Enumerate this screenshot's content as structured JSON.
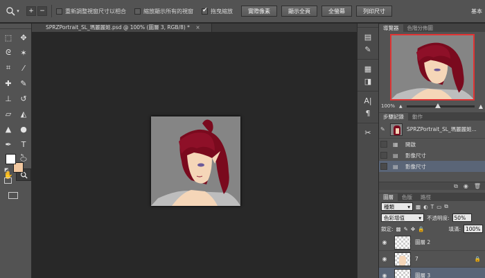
{
  "options_bar": {
    "zoom_in": "+",
    "zoom_out": "−",
    "check_resize_windows": "重新調整視窗尺寸以相合",
    "check_zoom_all_windows": "縮放顯示所有的視窗",
    "check_scrubby_zoom": "拖曳縮放",
    "btn_actual_pixels": "實際像素",
    "btn_fit_screen": "顯示全頁",
    "btn_fill_screen": "全螢幕",
    "btn_print_size": "列印尺寸",
    "workspace": "基本"
  },
  "document": {
    "tab_title": "SPRZPortrait_SL_瑪麗麗姬.psd @ 100% (圖層 3, RGB/8) *",
    "close": "×"
  },
  "navigator": {
    "tab_navigator": "導覽器",
    "tab_histogram": "色階分佈圖",
    "zoom": "100%",
    "zoom_fraction": 0.46
  },
  "history": {
    "tab_history": "步驟記錄",
    "tab_actions": "動作",
    "snapshot": "SPRZPortrait_SL_瑪麗麗姬...",
    "items": [
      {
        "label": "開啟"
      },
      {
        "label": "影像尺寸"
      },
      {
        "label": "影像尺寸"
      }
    ]
  },
  "layers": {
    "tab_layers": "圖層",
    "tab_channels": "色版",
    "tab_paths": "路徑",
    "filter_type": "種類",
    "blend_mode": "色彩增值",
    "opacity_label": "不透明度:",
    "opacity": "50%",
    "lock_label": "鎖定:",
    "fill_label": "填滿:",
    "fill": "100%",
    "rows": [
      {
        "name": "圖層 2"
      },
      {
        "name": "7"
      },
      {
        "name": "圖層 3"
      }
    ]
  },
  "colors": {
    "foreground": "#ffffff",
    "background": "#f2c8a0",
    "hair": "#7a0a1e",
    "skin": "#f5d6b8",
    "canvas_bg": "#858585"
  }
}
